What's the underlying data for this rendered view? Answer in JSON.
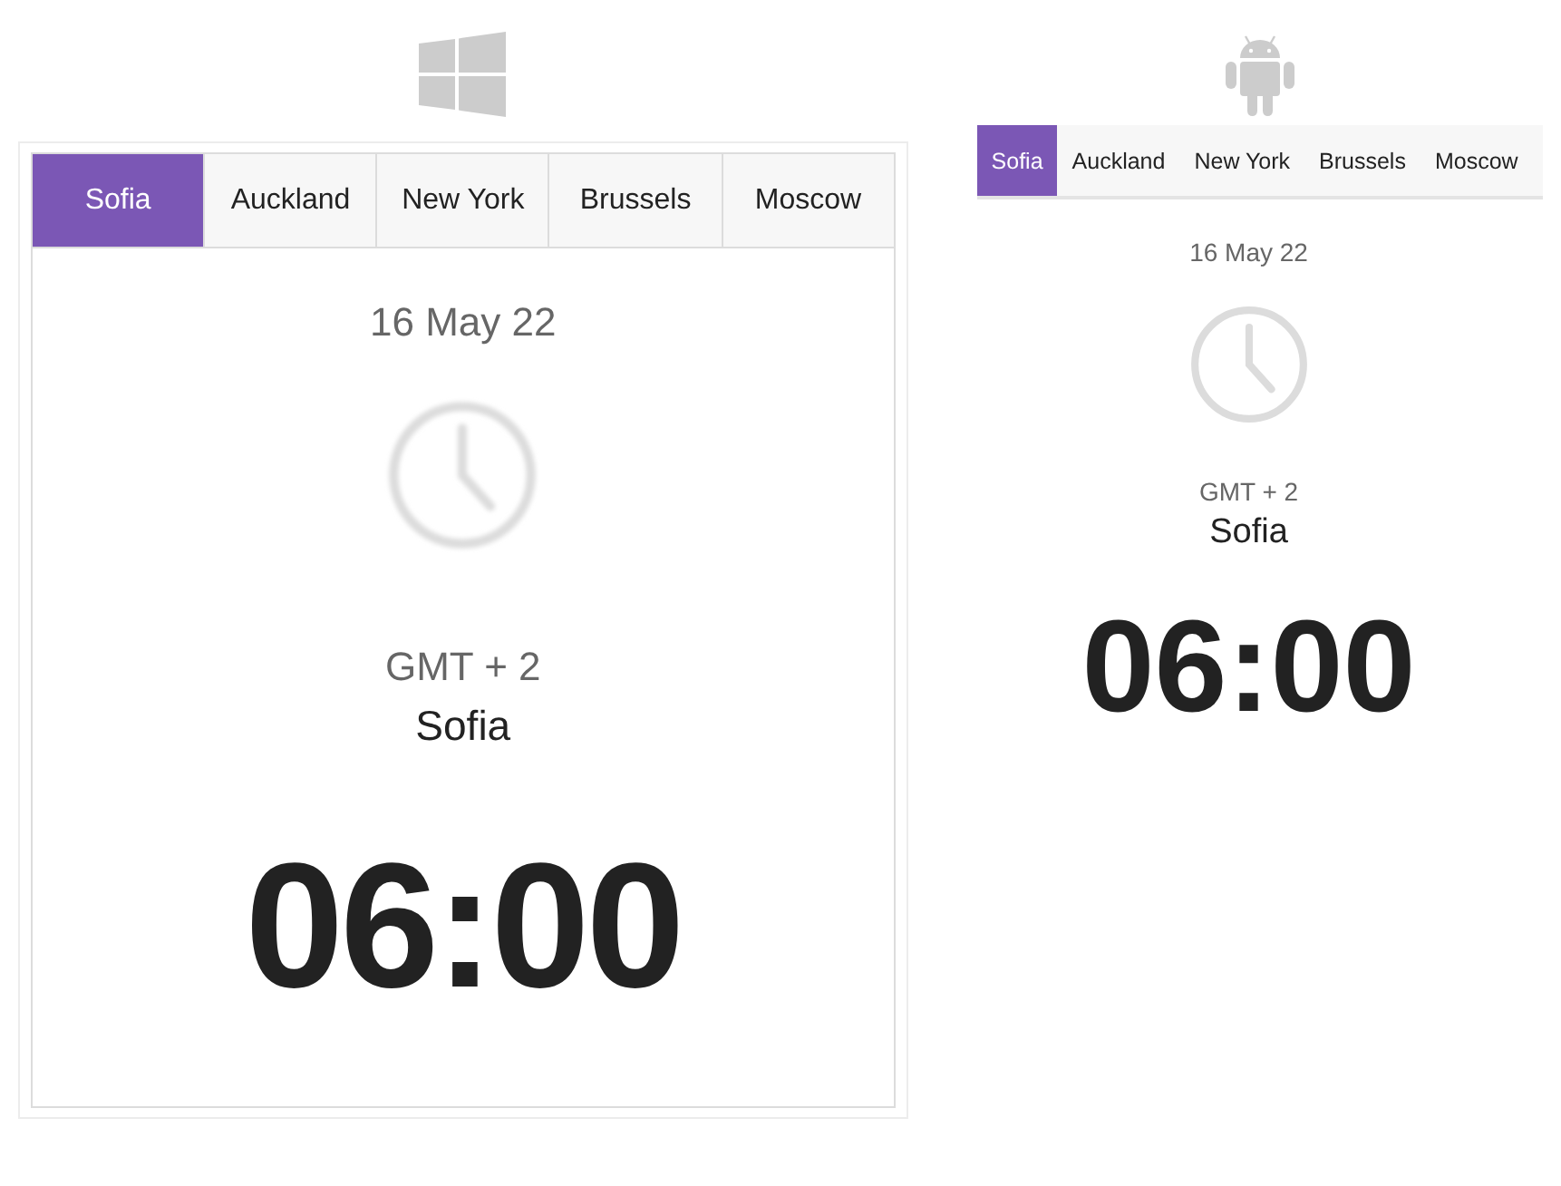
{
  "panels": [
    {
      "kind": "windows",
      "tabs": [
        {
          "label": "Sofia",
          "selected": true
        },
        {
          "label": "Auckland",
          "selected": false
        },
        {
          "label": "New York",
          "selected": false
        },
        {
          "label": "Brussels",
          "selected": false
        },
        {
          "label": "Moscow",
          "selected": false
        }
      ],
      "date": "16 May 22",
      "offset": "GMT + 2",
      "city": "Sofia",
      "time": "06:00"
    },
    {
      "kind": "android",
      "tabs": [
        {
          "label": "Sofia",
          "selected": true
        },
        {
          "label": "Auckland",
          "selected": false
        },
        {
          "label": "New York",
          "selected": false
        },
        {
          "label": "Brussels",
          "selected": false
        },
        {
          "label": "Moscow",
          "selected": false
        }
      ],
      "date": "16 May 22",
      "offset": "GMT + 2",
      "city": "Sofia",
      "time": "06:00"
    }
  ]
}
